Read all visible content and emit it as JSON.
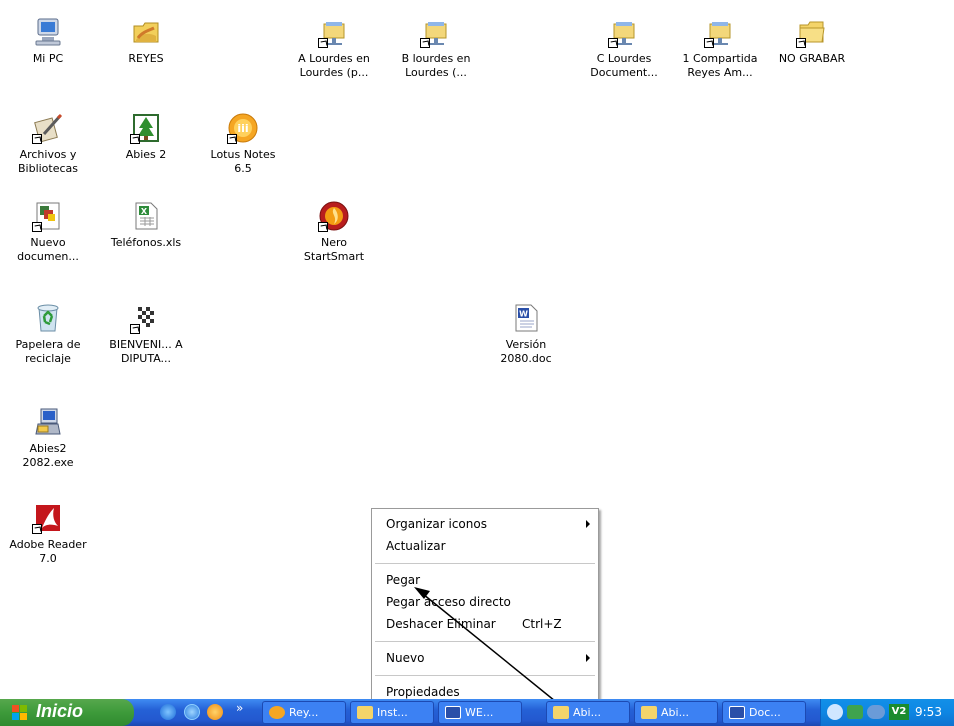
{
  "desktop": {
    "icons": [
      {
        "label": "Mi PC",
        "icon": "computer-icon"
      },
      {
        "label": "REYES",
        "icon": "shared-folder-icon"
      },
      {
        "label": "A Lourdes en Lourdes (p...",
        "icon": "network-drive-icon"
      },
      {
        "label": "B lourdes en Lourdes (...",
        "icon": "network-drive-icon"
      },
      {
        "label": "C Lourdes Document...",
        "icon": "network-drive-icon"
      },
      {
        "label": "1 Compartida Reyes Am...",
        "icon": "network-drive-icon"
      },
      {
        "label": "NO GRABAR",
        "icon": "folder-icon"
      },
      {
        "label": "Archivos y Bibliotecas",
        "icon": "library-icon"
      },
      {
        "label": "Abies 2",
        "icon": "tree-app-icon"
      },
      {
        "label": "Lotus Notes 6.5",
        "icon": "lotus-notes-icon"
      },
      {
        "label": "Nuevo documen...",
        "icon": "document-icon"
      },
      {
        "label": "Teléfonos.xls",
        "icon": "excel-file-icon"
      },
      {
        "label": "Nero StartSmart",
        "icon": "nero-icon"
      },
      {
        "label": "Papelera de reciclaje",
        "icon": "recycle-bin-icon"
      },
      {
        "label": "BIENVENI... A DIPUTA...",
        "icon": "pattern-image-icon"
      },
      {
        "label": "Versión 2080.doc",
        "icon": "word-doc-icon"
      },
      {
        "label": "Abies2 2082.exe",
        "icon": "installer-icon"
      },
      {
        "label": "Adobe Reader 7.0",
        "icon": "adobe-reader-icon"
      }
    ]
  },
  "context_menu": {
    "items": [
      {
        "label": "Organizar iconos",
        "submenu": true
      },
      {
        "label": "Actualizar"
      },
      {
        "label": "Pegar"
      },
      {
        "label": "Pegar acceso directo"
      },
      {
        "label": "Deshacer Eliminar",
        "shortcut": "Ctrl+Z"
      },
      {
        "label": "Nuevo",
        "submenu": true
      },
      {
        "label": "Propiedades"
      }
    ]
  },
  "taskbar": {
    "start_label": "Inicio",
    "quick_launch": [
      "internet-explorer-icon",
      "ie-icon",
      "lotus-notes-icon"
    ],
    "overflow": "»",
    "buttons": [
      {
        "label": "Rey...",
        "icon": "lotus-notes-icon"
      },
      {
        "label": "Inst...",
        "icon": "folder-icon"
      },
      {
        "label": "WE...",
        "icon": "word-icon"
      },
      {
        "label": "Abi...",
        "icon": "folder-icon"
      },
      {
        "label": "Abi...",
        "icon": "folder-icon"
      },
      {
        "label": "Doc...",
        "icon": "word-icon"
      }
    ],
    "clock": "9:53"
  },
  "colors": {
    "taskbar": "#2561d6",
    "start_button": "#3d9a3a",
    "tray": "#0e86e3"
  }
}
